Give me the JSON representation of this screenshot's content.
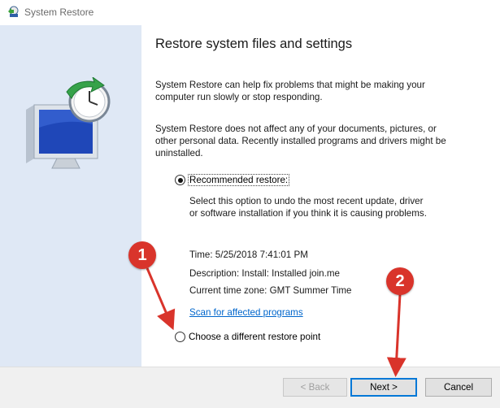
{
  "window": {
    "title": "System Restore",
    "icon": "system-restore-icon"
  },
  "main": {
    "heading": "Restore system files and settings",
    "para1_line1": "System Restore can help fix problems that might be making your",
    "para1_line2": "computer run slowly or stop responding.",
    "para2_line1": "System Restore does not affect any of your documents, pictures, or",
    "para2_line2": "other personal data. Recently installed programs and drivers might be",
    "para2_line3": "uninstalled.",
    "recommended_label": "Recommended restore:",
    "recommended_desc_line1": "Select this option to undo the most recent update, driver",
    "recommended_desc_line2": "or software installation if you think it is causing problems.",
    "time": "Time: 5/25/2018 7:41:01 PM",
    "description": "Description: Install: Installed join.me",
    "timezone": "Current time zone: GMT Summer Time",
    "scan_link": "Scan for affected programs",
    "different_label": "Choose a different restore point"
  },
  "buttons": {
    "back": "< Back",
    "next": "Next >",
    "cancel": "Cancel"
  },
  "annotations": {
    "badge1": "1",
    "badge2": "2",
    "accent_color": "#d9342b"
  }
}
